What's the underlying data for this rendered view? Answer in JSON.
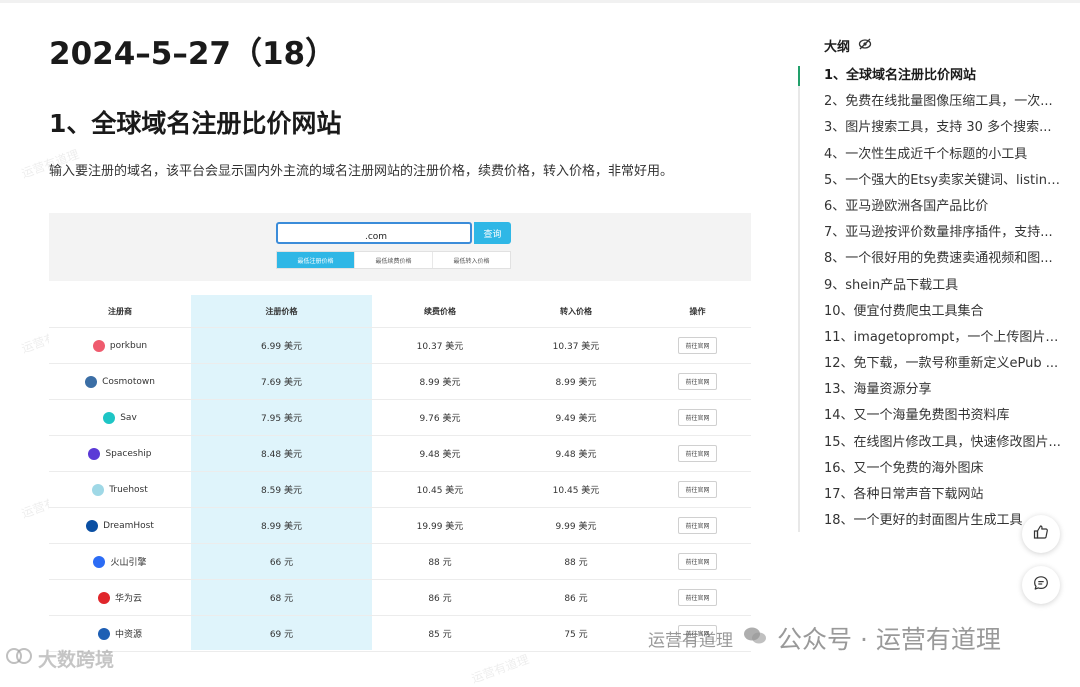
{
  "document": {
    "title": "2024–5–27（18）",
    "section_heading": "1、全球域名注册比价网站",
    "intro": "输入要注册的域名，该平台会显示国内外主流的域名注册网站的注册价格，续费价格，转入价格，非常好用。"
  },
  "embedded_screenshot": {
    "search_value": ".com",
    "search_button": "查询",
    "sort_tabs": [
      "最低注册价格",
      "最低续费价格",
      "最低转入价格"
    ],
    "active_sort_tab": 0,
    "headers": [
      "注册商",
      "注册价格",
      "续费价格",
      "转入价格",
      "操作"
    ],
    "rows": [
      {
        "registrar": "porkbun",
        "logo_color": "#ef5b6e",
        "register": "6.99 美元",
        "renew": "10.37 美元",
        "transfer": "10.37 美元",
        "action": "前往官网"
      },
      {
        "registrar": "Cosmotown",
        "logo_color": "#3b6ea5",
        "register": "7.69 美元",
        "renew": "8.99 美元",
        "transfer": "8.99 美元",
        "action": "前往官网"
      },
      {
        "registrar": "Sav",
        "logo_color": "#1ec5c5",
        "register": "7.95 美元",
        "renew": "9.76 美元",
        "transfer": "9.49 美元",
        "action": "前往官网"
      },
      {
        "registrar": "Spaceship",
        "logo_color": "#5b3ad6",
        "register": "8.48 美元",
        "renew": "9.48 美元",
        "transfer": "9.48 美元",
        "action": "前往官网"
      },
      {
        "registrar": "Truehost",
        "logo_color": "#9fd8e6",
        "register": "8.59 美元",
        "renew": "10.45 美元",
        "transfer": "10.45 美元",
        "action": "前往官网"
      },
      {
        "registrar": "DreamHost",
        "logo_color": "#0a4fa3",
        "register": "8.99 美元",
        "renew": "19.99 美元",
        "transfer": "9.99 美元",
        "action": "前往官网"
      },
      {
        "registrar": "火山引擎",
        "logo_color": "#2c6cf5",
        "register": "66 元",
        "renew": "88 元",
        "transfer": "88 元",
        "action": "前往官网"
      },
      {
        "registrar": "华为云",
        "logo_color": "#e0262b",
        "register": "68 元",
        "renew": "86 元",
        "transfer": "86 元",
        "action": "前往官网"
      },
      {
        "registrar": "中资源",
        "logo_color": "#1e5fb4",
        "register": "69 元",
        "renew": "85 元",
        "transfer": "75 元",
        "action": "前往官网"
      }
    ]
  },
  "outline": {
    "title": "大纲",
    "icon": "eye-off-icon",
    "active_index": 0,
    "accent_color": "#22a06b",
    "items": [
      "1、全球域名注册比价网站",
      "2、免费在线批量图像压缩工具，一次...",
      "3、图片搜索工具，支持 30 多个搜索...",
      "4、一次性生成近千个标题的小工具",
      "5、一个强大的Etsy卖家关键词、listing...",
      "6、亚马逊欧洲各国产品比价",
      "7、亚马逊按评价数量排序插件，支持...",
      "8、一个很好用的免费速卖通视频和图...",
      "9、shein产品下载工具",
      "10、便宜付费爬虫工具集合",
      "11、imagetoprompt，一个上传图片后...",
      "12、免下载，一款号称重新定义ePub ...",
      "13、海量资源分享",
      "14、又一个海量免费图书资料库",
      "15、在线图片修改工具，快速修改图片...",
      "16、又一个免费的海外图床",
      "17、各种日常声音下载网站",
      "18、一个更好的封面图片生成工具"
    ]
  },
  "floating_actions": {
    "like_icon": "thumbs-up-icon",
    "comment_icon": "comment-icon"
  },
  "watermarks": {
    "faint": "运营有道理",
    "wechat_small": "运营有道理",
    "wechat_big": "公众号 · 运营有道理",
    "brand": "大数跨境"
  }
}
